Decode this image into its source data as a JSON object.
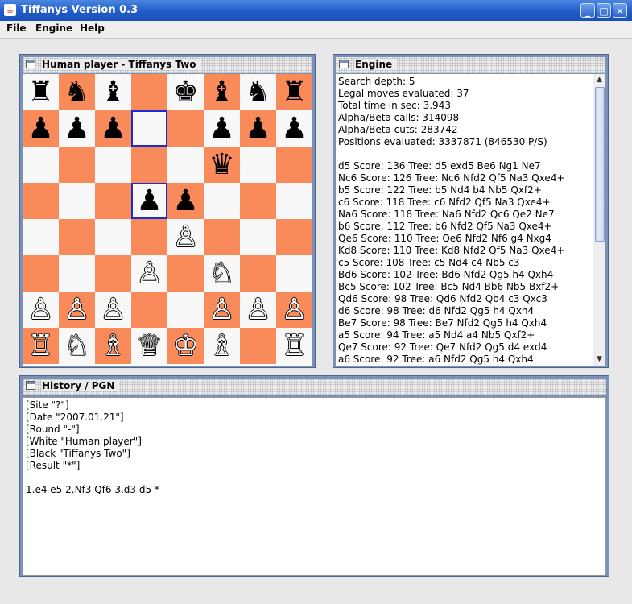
{
  "window": {
    "title": "Tiffanys Version 0.3",
    "icon": "java-coffee-icon",
    "minimize": "_",
    "maximize": "□",
    "close": "✕"
  },
  "menu": {
    "file": "File",
    "engine": "Engine",
    "help": "Help"
  },
  "board_frame": {
    "title": "Human player   -   Tiffanys Two"
  },
  "board": {
    "light_color": "#f8f8f8",
    "dark_color": "#f98a5a",
    "highlight_color": "#1c2bd6",
    "highlighted_squares": [
      "d7",
      "d5"
    ],
    "rows": [
      [
        "♜",
        "♞",
        "♝",
        "",
        "♚",
        "♝",
        "♞",
        "♜"
      ],
      [
        "♟",
        "♟",
        "♟",
        "",
        "",
        "♟",
        "♟",
        "♟"
      ],
      [
        "",
        "",
        "",
        "",
        "",
        "♛",
        "",
        ""
      ],
      [
        "",
        "",
        "",
        "♟",
        "♟",
        "",
        "",
        ""
      ],
      [
        "",
        "",
        "",
        "",
        "♙",
        "",
        "",
        ""
      ],
      [
        "",
        "",
        "",
        "♙",
        "",
        "♘",
        "",
        ""
      ],
      [
        "♙",
        "♙",
        "♙",
        "",
        "",
        "♙",
        "♙",
        "♙"
      ],
      [
        "♖",
        "♘",
        "♗",
        "♕",
        "♔",
        "♗",
        "",
        "♖"
      ]
    ]
  },
  "engine_frame": {
    "title": "Engine",
    "lines": [
      "Search depth: 5",
      "Legal moves evaluated: 37",
      "Total time in sec: 3.943",
      "Alpha/Beta calls: 314098",
      "Alpha/Beta cuts: 283742",
      "Positions evaluated: 3337871 (846530 P/S)",
      "",
      "d5 Score: 136 Tree: d5 exd5 Be6 Ng1 Ne7",
      "Nc6 Score: 126 Tree: Nc6 Nfd2 Qf5 Na3 Qxe4+",
      "b5 Score: 122 Tree: b5 Nd4 b4 Nb5 Qxf2+",
      "c6 Score: 118 Tree: c6 Nfd2 Qf5 Na3 Qxe4+",
      "Na6 Score: 118 Tree: Na6 Nfd2 Qc6 Qe2 Ne7",
      "b6 Score: 112 Tree: b6 Nfd2 Qf5 Na3 Qxe4+",
      "Qe6 Score: 110 Tree: Qe6 Nfd2 Nf6 g4 Nxg4",
      "Kd8 Score: 110 Tree: Kd8 Nfd2 Qf5 Na3 Qxe4+",
      "c5 Score: 108 Tree: c5 Nd4 c4 Nb5 c3",
      "Bd6 Score: 102 Tree: Bd6 Nfd2 Qg5 h4 Qxh4",
      "Bc5 Score: 102 Tree: Bc5 Nd4 Bb6 Nb5 Bxf2+",
      "Qd6 Score: 98 Tree: Qd6 Nfd2 Qb4 c3 Qxc3",
      "d6 Score: 98 Tree: d6 Nfd2 Qg5 h4 Qxh4",
      "Be7 Score: 98 Tree: Be7 Nfd2 Qg5 h4 Qxh4",
      "a5 Score: 94 Tree: a5 Nd4 a4 Nb5 Qxf2+",
      "Qe7 Score: 92 Tree: Qe7 Nfd2 Qg5 d4 exd4",
      "a6 Score: 92 Tree: a6 Nfd2 Qg5 h4 Qxh4"
    ]
  },
  "history_frame": {
    "title": "History  /  PGN",
    "lines": [
      "[Site \"?\"]",
      "[Date \"2007.01.21\"]",
      "[Round \"-\"]",
      "[White \"Human player\"]",
      "[Black \"Tiffanys Two\"]",
      "[Result \"*\"]",
      "",
      "1.e4 e5 2.Nf3 Qf6 3.d3 d5 *"
    ]
  },
  "scroll": {
    "up": "▲",
    "down": "▼"
  }
}
